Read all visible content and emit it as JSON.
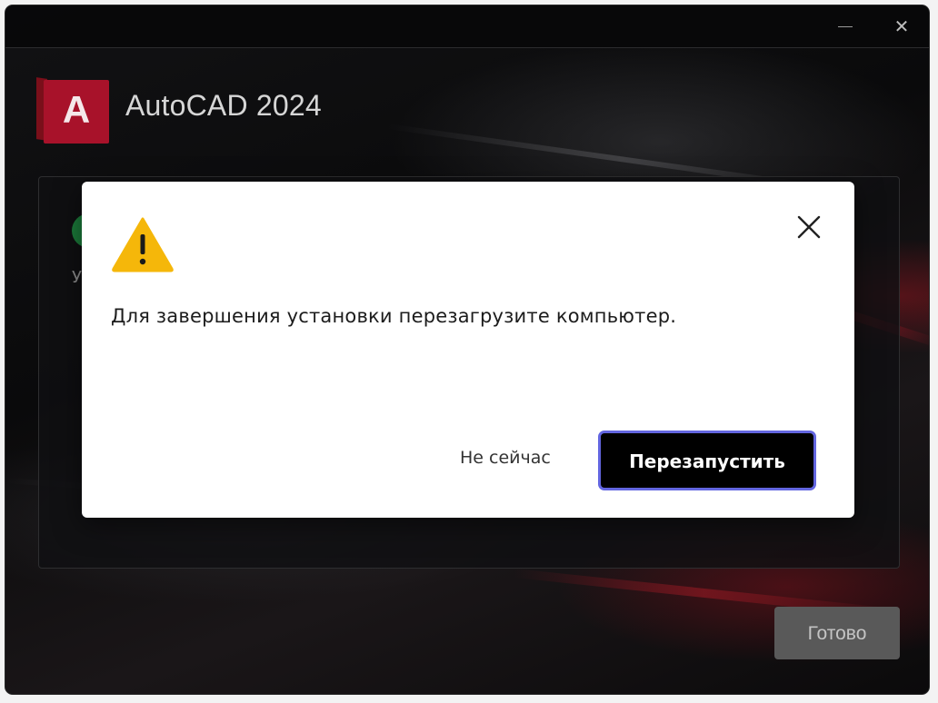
{
  "window": {
    "title": "",
    "minimize_symbol": "—",
    "close_symbol": "✕"
  },
  "header": {
    "logo_letter": "A",
    "product_name": "AutoCAD 2024"
  },
  "panel": {
    "status_text": "У"
  },
  "footer": {
    "done_label": "Готово"
  },
  "dialog": {
    "icon": "warning-icon",
    "message": "Для завершения установки перезагрузите компьютер.",
    "not_now_label": "Не сейчас",
    "restart_label": "Перезапустить",
    "close_icon": "close-icon"
  },
  "colors": {
    "brand": "#a8122a",
    "warning": "#f5b70a",
    "primary_button": "#000000",
    "focus_ring": "#6366e0",
    "success": "#1b7a3a"
  }
}
